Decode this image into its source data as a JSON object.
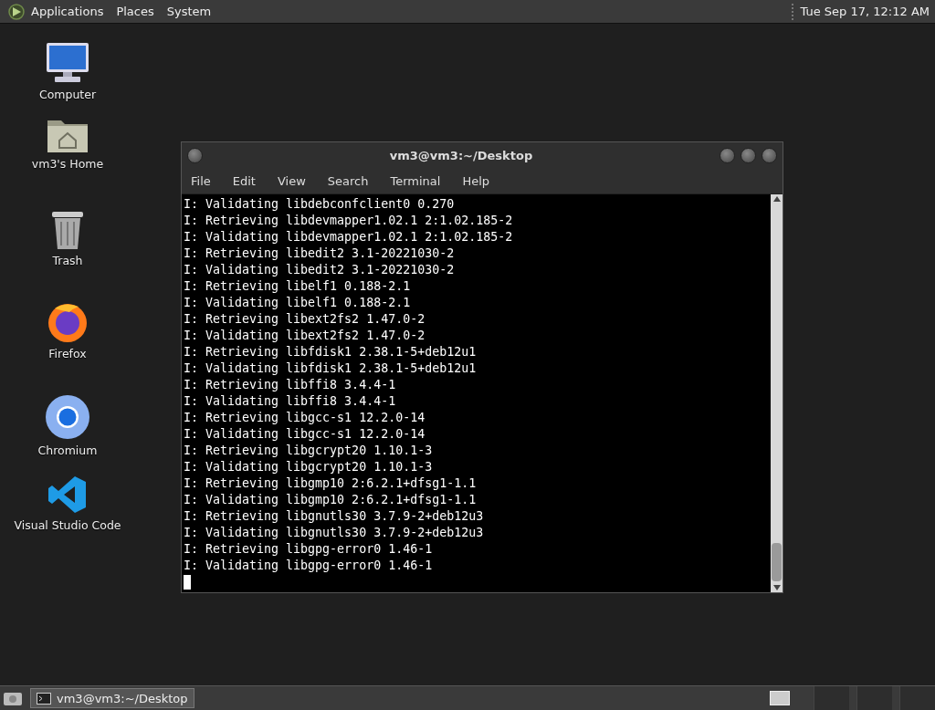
{
  "top_panel": {
    "menus": [
      "Applications",
      "Places",
      "System"
    ],
    "clock": "Tue Sep 17, 12:12 AM"
  },
  "desktop_icons": [
    {
      "kind": "computer",
      "label": "Computer"
    },
    {
      "kind": "home",
      "label": "vm3's Home"
    },
    {
      "kind": "trash",
      "label": "Trash"
    },
    {
      "kind": "firefox",
      "label": "Firefox"
    },
    {
      "kind": "chromium",
      "label": "Chromium"
    },
    {
      "kind": "vscode",
      "label": "Visual Studio Code"
    }
  ],
  "terminal": {
    "title": "vm3@vm3:~/Desktop",
    "menu": [
      "File",
      "Edit",
      "View",
      "Search",
      "Terminal",
      "Help"
    ],
    "lines": [
      "I: Validating libdebconfclient0 0.270",
      "I: Retrieving libdevmapper1.02.1 2:1.02.185-2",
      "I: Validating libdevmapper1.02.1 2:1.02.185-2",
      "I: Retrieving libedit2 3.1-20221030-2",
      "I: Validating libedit2 3.1-20221030-2",
      "I: Retrieving libelf1 0.188-2.1",
      "I: Validating libelf1 0.188-2.1",
      "I: Retrieving libext2fs2 1.47.0-2",
      "I: Validating libext2fs2 1.47.0-2",
      "I: Retrieving libfdisk1 2.38.1-5+deb12u1",
      "I: Validating libfdisk1 2.38.1-5+deb12u1",
      "I: Retrieving libffi8 3.4.4-1",
      "I: Validating libffi8 3.4.4-1",
      "I: Retrieving libgcc-s1 12.2.0-14",
      "I: Validating libgcc-s1 12.2.0-14",
      "I: Retrieving libgcrypt20 1.10.1-3",
      "I: Validating libgcrypt20 1.10.1-3",
      "I: Retrieving libgmp10 2:6.2.1+dfsg1-1.1",
      "I: Validating libgmp10 2:6.2.1+dfsg1-1.1",
      "I: Retrieving libgnutls30 3.7.9-2+deb12u3",
      "I: Validating libgnutls30 3.7.9-2+deb12u3",
      "I: Retrieving libgpg-error0 1.46-1",
      "I: Validating libgpg-error0 1.46-1"
    ]
  },
  "taskbar": {
    "windows": [
      {
        "label": "vm3@vm3:~/Desktop",
        "selected": true
      }
    ]
  }
}
